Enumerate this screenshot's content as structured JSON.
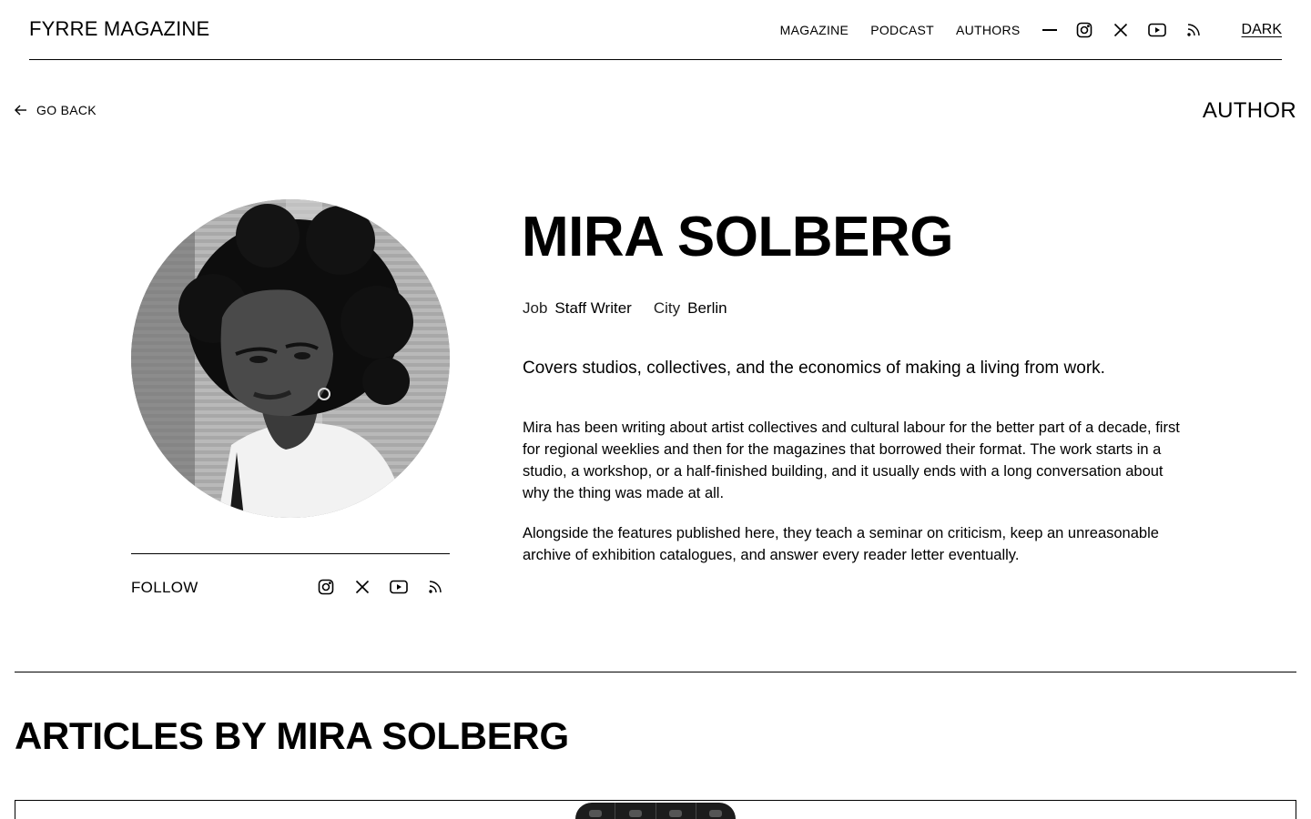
{
  "header": {
    "logo": "FYRRE MAGAZINE",
    "nav": [
      {
        "label": "MAGAZINE"
      },
      {
        "label": "PODCAST"
      },
      {
        "label": "AUTHORS"
      }
    ],
    "social_icons": [
      "instagram-icon",
      "x-icon",
      "youtube-icon",
      "rss-icon"
    ],
    "theme_toggle": "DARK"
  },
  "subbar": {
    "back_label": "GO BACK",
    "page_label": "AUTHOR"
  },
  "author": {
    "name": "MIRA SOLBERG",
    "job_key": "Job",
    "job_value": "Staff Writer",
    "city_key": "City",
    "city_value": "Berlin",
    "tagline": "Covers studios, collectives, and the economics of making a living from work.",
    "bio": [
      "Mira has been writing about artist collectives and cultural labour for the better part of a decade, first for regional weeklies and then for the magazines that borrowed their format. The work starts in a studio, a workshop, or a half-finished building, and it usually ends with a long conversation about why the thing was made at all.",
      "Alongside the features published here, they teach a seminar on criticism, keep an unreasonable archive of exhibition catalogues, and answer every reader letter eventually."
    ],
    "follow_label": "FOLLOW",
    "follow_icons": [
      "instagram-icon",
      "x-icon",
      "youtube-icon",
      "rss-icon"
    ]
  },
  "articles": {
    "title": "ARTICLES BY MIRA SOLBERG"
  },
  "colors": {
    "text": "#000000",
    "background": "#ffffff",
    "toolbar": "#1c1c1c"
  }
}
